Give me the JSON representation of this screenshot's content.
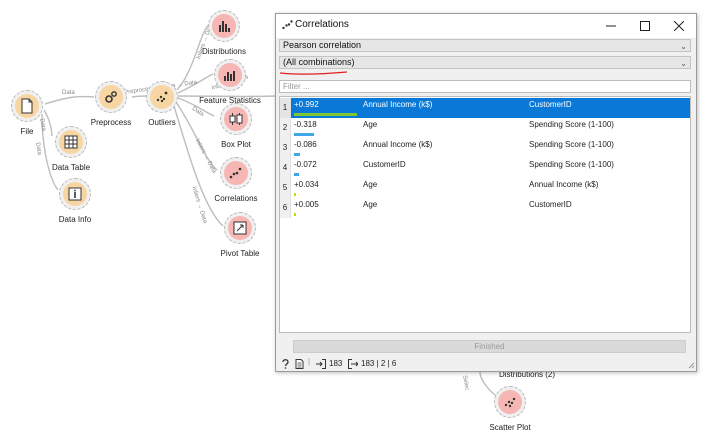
{
  "canvas": {
    "nodes": {
      "file": {
        "label": "File"
      },
      "data_table": {
        "label": "Data Table"
      },
      "data_info": {
        "label": "Data Info"
      },
      "preprocess": {
        "label": "Preprocess"
      },
      "outliers": {
        "label": "Outliers"
      },
      "distributions": {
        "label": "Distributions"
      },
      "feature_statistics": {
        "label": "Feature Statistics"
      },
      "box_plot": {
        "label": "Box Plot"
      },
      "correlations": {
        "label": "Correlations"
      },
      "pivot_table": {
        "label": "Pivot Table"
      },
      "distributions_2": {
        "label": "Distributions (2)"
      },
      "scatter_plot": {
        "label": "Scatter Plot"
      }
    },
    "link_labels": {
      "file_preprocess": "Data",
      "file_datatable": "Data",
      "file_datainfo": "Data",
      "preprocess_outliers": "Preprocessed Data → Data",
      "outliers_distributions": "Inliers → Data",
      "outliers_features": "Inliers → Data",
      "outliers_boxplot": "Data",
      "outliers_correlations": "Inliers → Data",
      "outliers_pivot": "Inliers → Data",
      "to_scatter": "Selec"
    }
  },
  "dialog": {
    "title": "Correlations",
    "correlation_type": "Pearson correlation",
    "feature_selection": "(All combinations)",
    "filter_placeholder": "Filter ...",
    "rows": [
      {
        "index": "1",
        "value": "+0.992",
        "abs": 0.992,
        "feature_1": "Annual Income (k$)",
        "feature_2": "CustomerID",
        "color": "#7fc732",
        "selected": true
      },
      {
        "index": "2",
        "value": "-0.318",
        "abs": 0.318,
        "feature_1": "Age",
        "feature_2": "Spending Score (1-100)",
        "color": "#3fa7e6",
        "selected": false
      },
      {
        "index": "3",
        "value": "-0.086",
        "abs": 0.086,
        "feature_1": "Annual Income (k$)",
        "feature_2": "Spending Score (1-100)",
        "color": "#3fa7e6",
        "selected": false
      },
      {
        "index": "4",
        "value": "-0.072",
        "abs": 0.072,
        "feature_1": "CustomerID",
        "feature_2": "Spending Score (1-100)",
        "color": "#3fa7e6",
        "selected": false
      },
      {
        "index": "5",
        "value": "+0.034",
        "abs": 0.034,
        "feature_1": "Age",
        "feature_2": "Annual Income (k$)",
        "color": "#c5d81a",
        "selected": false
      },
      {
        "index": "6",
        "value": "+0.005",
        "abs": 0.005,
        "feature_1": "Age",
        "feature_2": "CustomerID",
        "color": "#c5d81a",
        "selected": false
      }
    ],
    "progress_label": "Finished",
    "status": {
      "input_count": "183",
      "output_summary": "183 | 2 | 6"
    }
  }
}
